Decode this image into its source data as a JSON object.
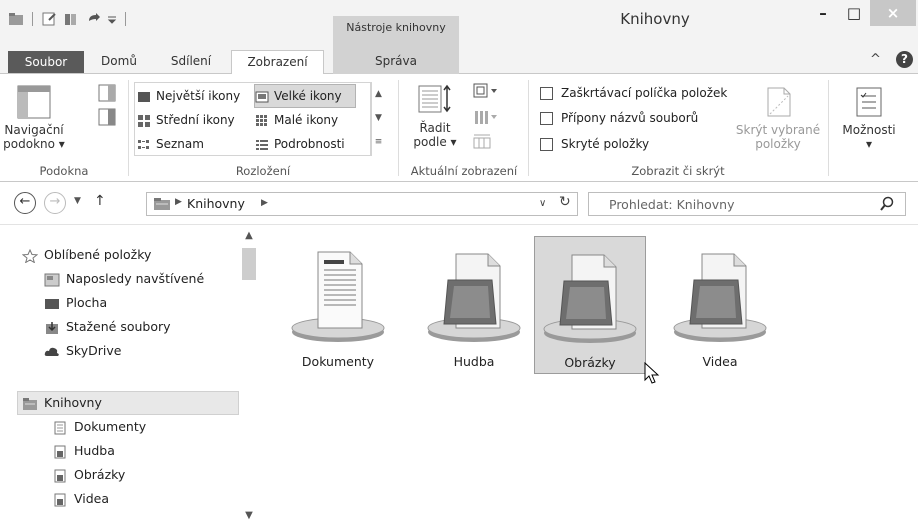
{
  "window": {
    "title": "Knihovny",
    "context_tab_group": "Nástroje knihovny",
    "controls": {
      "minimize": "–",
      "maximize": "□",
      "close": "×"
    }
  },
  "ribbon_tabs": [
    {
      "label": "Soubor"
    },
    {
      "label": "Domů"
    },
    {
      "label": "Sdílení"
    },
    {
      "label": "Zobrazení",
      "active": true
    },
    {
      "label": "Správa"
    }
  ],
  "ribbon": {
    "panes_group": {
      "label": "Podokna",
      "nav_pane_button": [
        "Navigační",
        "podokno ▾"
      ]
    },
    "layout_group": {
      "label": "Rozložení",
      "items": [
        "Největší ikony",
        "Velké ikony",
        "Střední ikony",
        "Malé ikony",
        "Seznam",
        "Podrobnosti"
      ],
      "selected": "Velké ikony"
    },
    "current_view_group": {
      "label": "Aktuální zobrazení",
      "sort_button": [
        "Řadit",
        "podle ▾"
      ]
    },
    "show_hide_group": {
      "label": "Zobrazit či skrýt",
      "checkboxes": [
        "Zaškrtávací políčka položek",
        "Přípony názvů souborů",
        "Skryté položky"
      ],
      "hide_selected": [
        "Skrýt vybrané",
        "položky"
      ]
    },
    "options": {
      "label": "Možnosti",
      "arrow": "▾"
    }
  },
  "address_bar": {
    "path": "Knihovny",
    "search_placeholder": "Prohledat: Knihovny"
  },
  "nav_pane": {
    "favorites": {
      "label": "Oblíbené položky",
      "items": [
        "Naposledy navštívené",
        "Plocha",
        "Stažené soubory",
        "SkyDrive"
      ]
    },
    "libraries": {
      "label": "Knihovny",
      "items": [
        "Dokumenty",
        "Hudba",
        "Obrázky",
        "Videa"
      ]
    }
  },
  "content": {
    "libraries": [
      {
        "name": "Dokumenty",
        "icon": "documents-library-icon"
      },
      {
        "name": "Hudba",
        "icon": "music-library-icon"
      },
      {
        "name": "Obrázky",
        "icon": "pictures-library-icon",
        "selected": true
      },
      {
        "name": "Videa",
        "icon": "videos-library-icon"
      }
    ]
  }
}
